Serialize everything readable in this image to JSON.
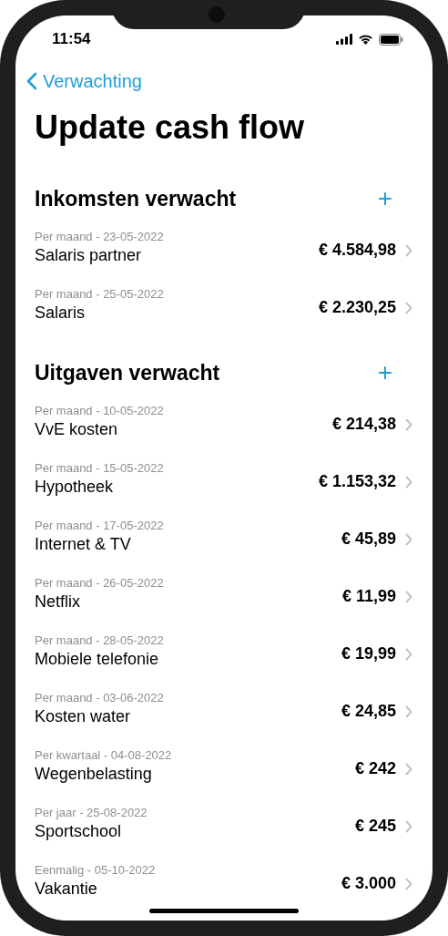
{
  "status_bar": {
    "time": "11:54"
  },
  "nav": {
    "back_label": "Verwachting"
  },
  "title": "Update cash flow",
  "sections": [
    {
      "title": "Inkomsten verwacht",
      "add_label": "+",
      "rows": [
        {
          "schedule": "Per maand - 23-05-2022",
          "name": "Salaris partner",
          "amount": "€ 4.584,98"
        },
        {
          "schedule": "Per maand - 25-05-2022",
          "name": "Salaris",
          "amount": "€ 2.230,25"
        }
      ]
    },
    {
      "title": "Uitgaven verwacht",
      "add_label": "+",
      "rows": [
        {
          "schedule": "Per maand - 10-05-2022",
          "name": "VvE kosten",
          "amount": "€ 214,38"
        },
        {
          "schedule": "Per maand - 15-05-2022",
          "name": "Hypotheek",
          "amount": "€ 1.153,32"
        },
        {
          "schedule": "Per maand - 17-05-2022",
          "name": "Internet & TV",
          "amount": "€ 45,89"
        },
        {
          "schedule": "Per maand - 26-05-2022",
          "name": "Netflix",
          "amount": "€ 11,99"
        },
        {
          "schedule": "Per maand - 28-05-2022",
          "name": "Mobiele telefonie",
          "amount": "€ 19,99"
        },
        {
          "schedule": "Per maand - 03-06-2022",
          "name": "Kosten water",
          "amount": "€ 24,85"
        },
        {
          "schedule": "Per kwartaal - 04-08-2022",
          "name": "Wegenbelasting",
          "amount": "€ 242"
        },
        {
          "schedule": "Per jaar - 25-08-2022",
          "name": "Sportschool",
          "amount": "€ 245"
        },
        {
          "schedule": "Eenmalig - 05-10-2022",
          "name": "Vakantie",
          "amount": "€ 3.000"
        }
      ]
    }
  ]
}
